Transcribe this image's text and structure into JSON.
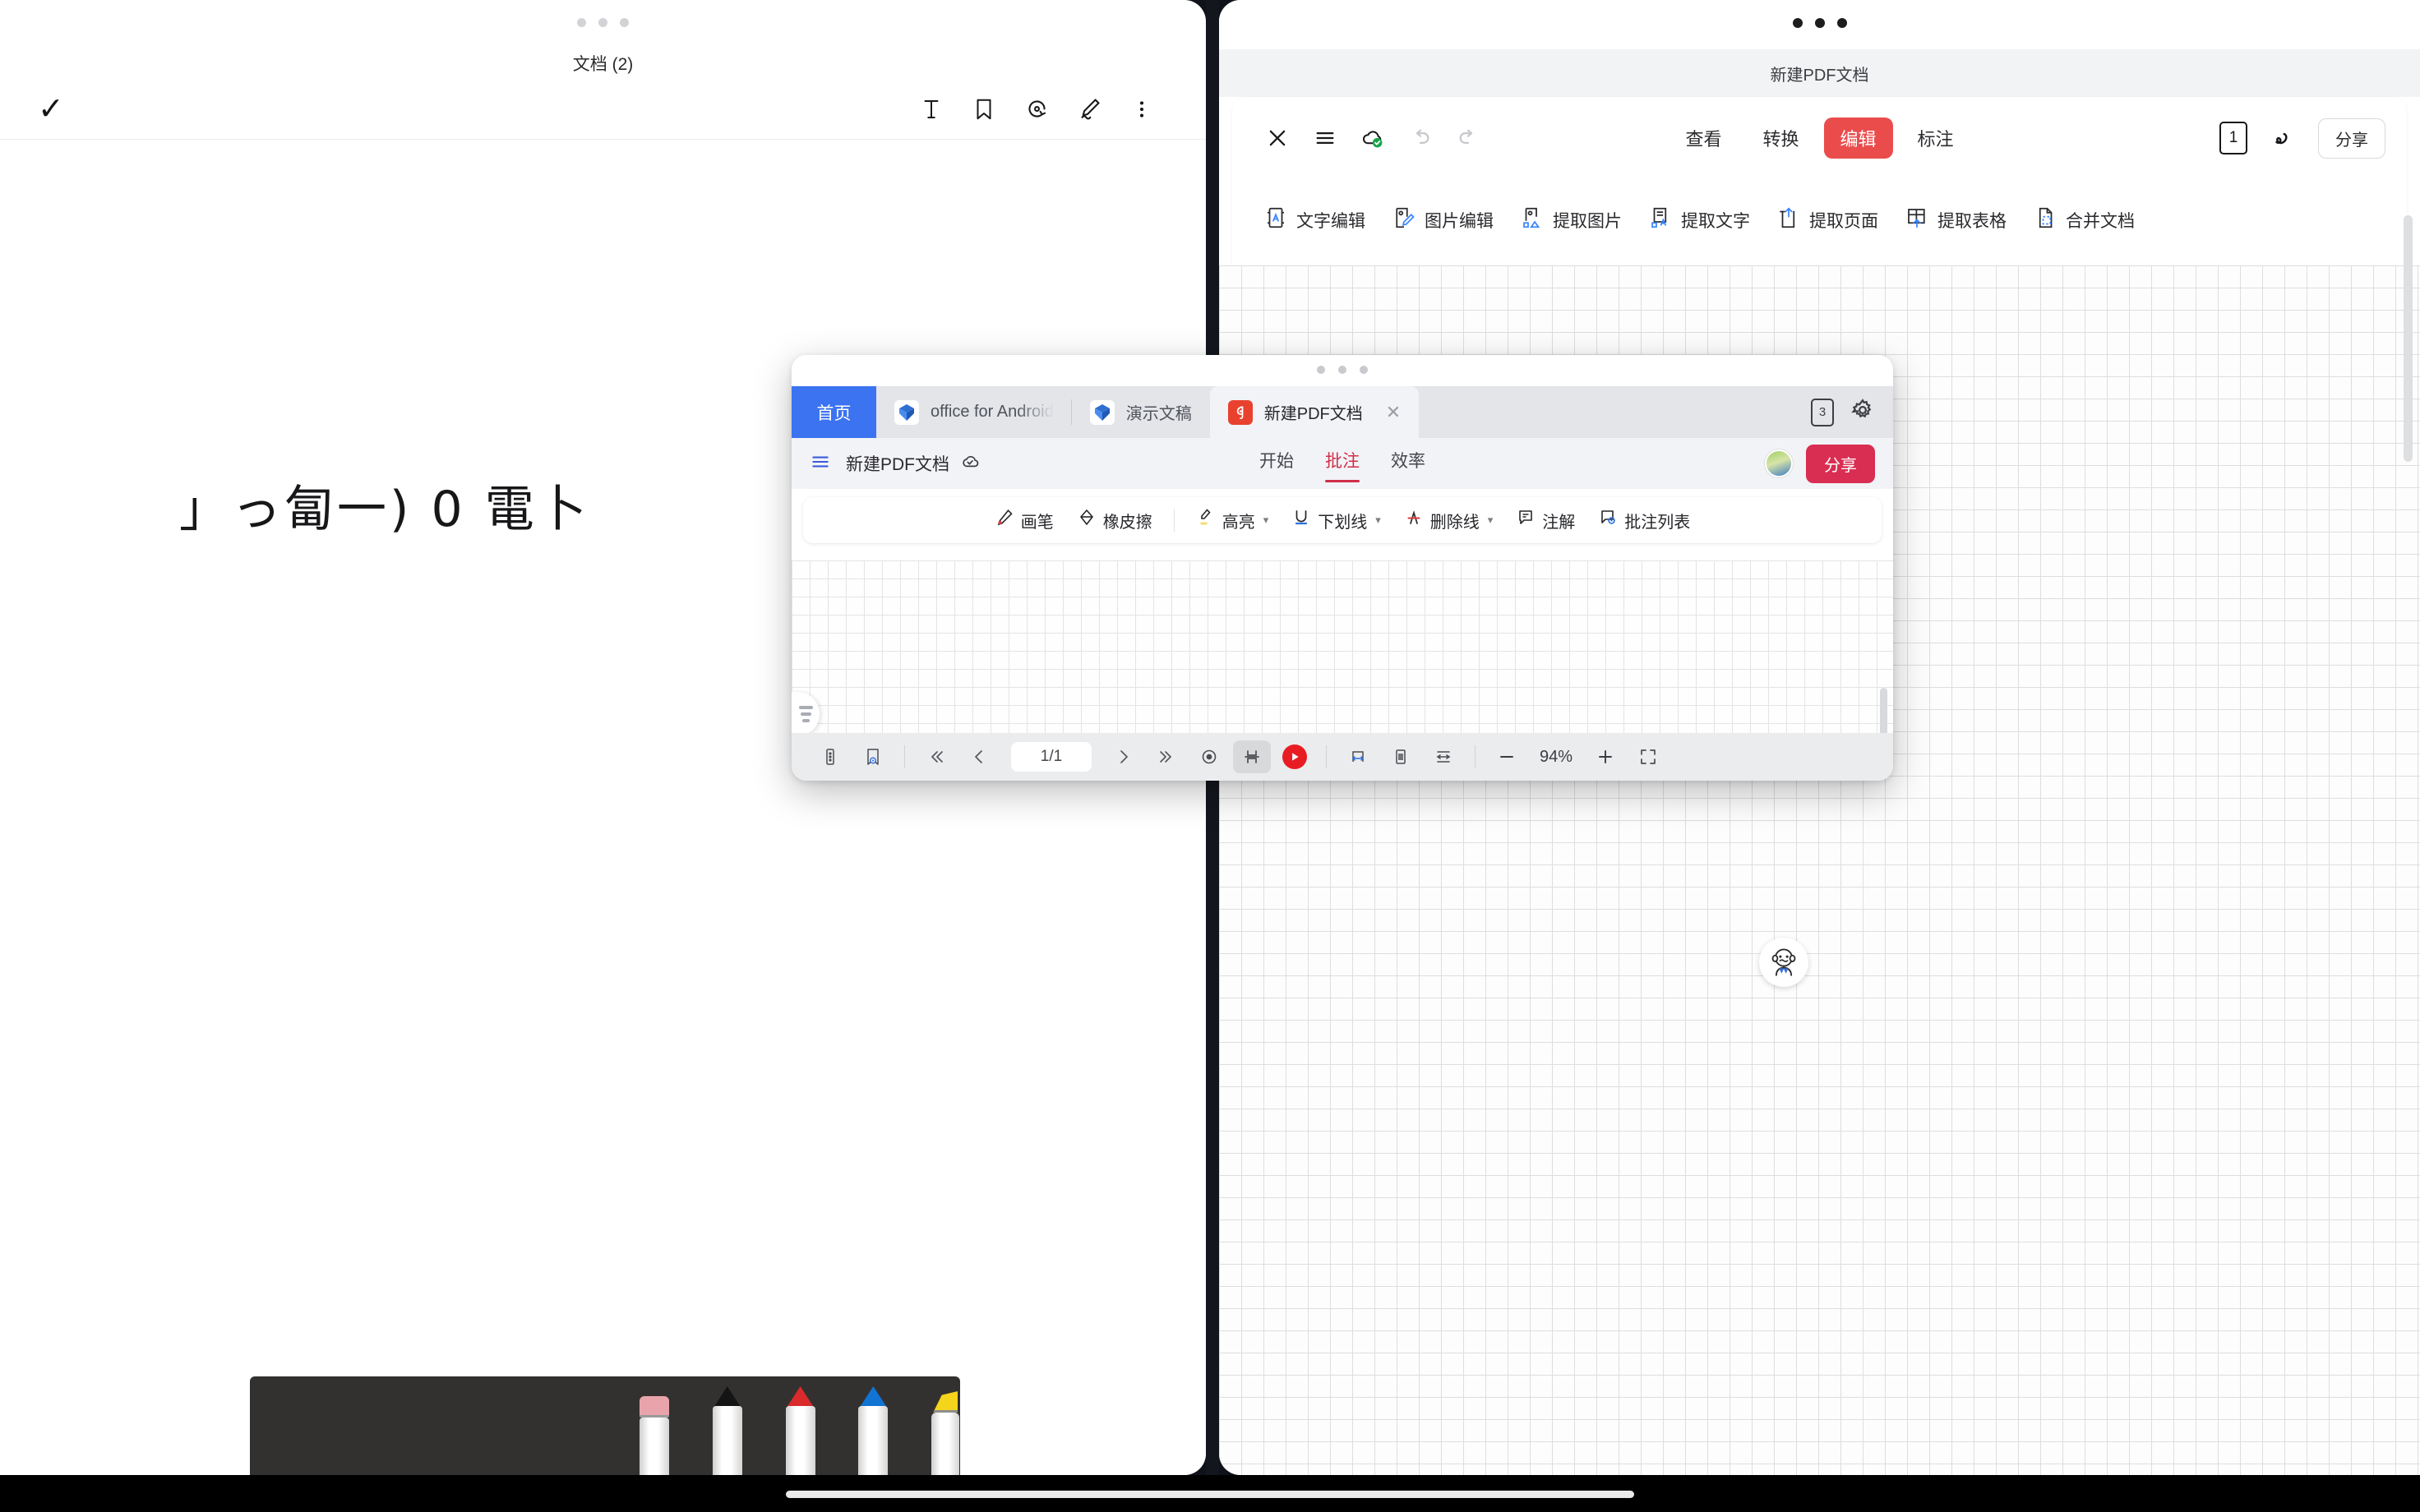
{
  "left_panel": {
    "title": "文档 (2)",
    "confirm_icon": "check-icon",
    "toolbar_icons": [
      "text-icon",
      "bookmark-icon",
      "lasso-rotate-icon",
      "pen-icon",
      "more-vertical-icon"
    ],
    "note_text": "」っ匐一) 0 電卜",
    "pens": [
      {
        "name": "eraser",
        "color": "#e9a4ab"
      },
      {
        "name": "black-pen",
        "color": "#141414"
      },
      {
        "name": "red-pen",
        "color": "#d92b2b"
      },
      {
        "name": "blue-pen",
        "color": "#1173d4"
      },
      {
        "name": "yellow-highlighter",
        "color": "#f5d41c"
      }
    ]
  },
  "right_panel": {
    "doc_title": "新建PDF文档",
    "close_label": "✕",
    "tabs": [
      {
        "label": "查看",
        "active": false
      },
      {
        "label": "转换",
        "active": false
      },
      {
        "label": "编辑",
        "active": true
      },
      {
        "label": "标注",
        "active": false
      }
    ],
    "page_count": "1",
    "share_label": "分享",
    "tools": [
      {
        "label": "文字编辑",
        "icon": "text-edit-icon"
      },
      {
        "label": "图片编辑",
        "icon": "image-edit-icon"
      },
      {
        "label": "提取图片",
        "icon": "extract-image-icon"
      },
      {
        "label": "提取文字",
        "icon": "extract-text-icon"
      },
      {
        "label": "提取页面",
        "icon": "extract-page-icon"
      },
      {
        "label": "提取表格",
        "icon": "extract-table-icon"
      },
      {
        "label": "合并文档",
        "icon": "merge-doc-icon"
      }
    ],
    "accent": "#ea4c4c"
  },
  "float_window": {
    "home_tab": "首页",
    "tabs": [
      {
        "label": "office for Android",
        "icon": "wps-icon",
        "active": false,
        "closable": false
      },
      {
        "label": "演示文稿",
        "icon": "wps-icon",
        "active": false,
        "closable": false
      },
      {
        "label": "新建PDF文档",
        "icon": "pdf-icon",
        "active": true,
        "closable": true
      }
    ],
    "window_count": "3",
    "settings_icon": "gear-icon",
    "doc_name": "新建PDF文档",
    "ribbon_tabs": [
      {
        "label": "开始",
        "active": false
      },
      {
        "label": "批注",
        "active": true
      },
      {
        "label": "效率",
        "active": false
      }
    ],
    "share_label": "分享",
    "annot_tools": [
      {
        "label": "画笔",
        "icon": "brush-icon",
        "caret": false
      },
      {
        "label": "橡皮擦",
        "icon": "eraser-icon",
        "caret": false
      },
      {
        "label": "高亮",
        "icon": "highlight-icon",
        "caret": true
      },
      {
        "label": "下划线",
        "icon": "underline-icon",
        "caret": true
      },
      {
        "label": "删除线",
        "icon": "strikethrough-icon",
        "caret": true
      },
      {
        "label": "注解",
        "icon": "comment-icon",
        "caret": false
      },
      {
        "label": "批注列表",
        "icon": "comment-list-icon",
        "caret": false
      }
    ],
    "page_indicator": "1/1",
    "zoom_level": "94%",
    "accent_red": "#d92d52",
    "accent_blue": "#3b73f0"
  }
}
